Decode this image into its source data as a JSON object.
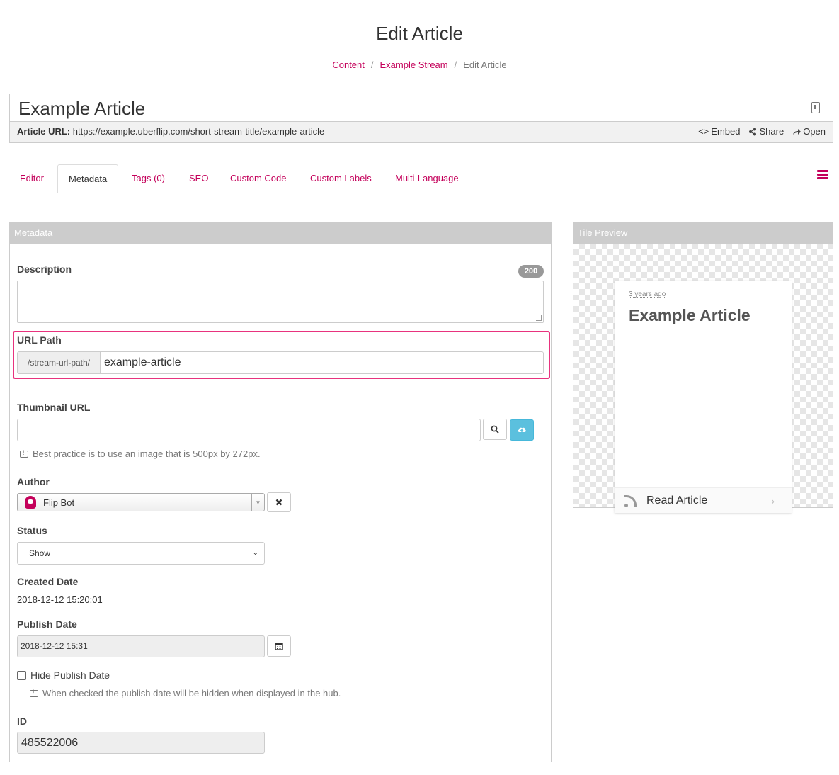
{
  "header": {
    "title": "Edit Article",
    "breadcrumb": [
      "Content",
      "Example Stream",
      "Edit Article"
    ]
  },
  "article": {
    "title": "Example Article",
    "url_label": "Article URL:",
    "url": "https://example.uberflip.com/short-stream-title/example-article",
    "actions": {
      "embed": "Embed",
      "share": "Share",
      "open": "Open"
    }
  },
  "tabs": [
    {
      "label": "Editor",
      "active": false
    },
    {
      "label": "Metadata",
      "active": true
    },
    {
      "label": "Tags (0)",
      "active": false
    },
    {
      "label": "SEO",
      "active": false
    },
    {
      "label": "Custom Code",
      "active": false
    },
    {
      "label": "Custom Labels",
      "active": false
    },
    {
      "label": "Multi-Language",
      "active": false
    }
  ],
  "metadata": {
    "heading": "Metadata",
    "description": {
      "label": "Description",
      "count": "200",
      "value": ""
    },
    "url_path": {
      "label": "URL Path",
      "prefix": "/stream-url-path/",
      "value": "example-article"
    },
    "thumbnail": {
      "label": "Thumbnail URL",
      "value": "",
      "help": "Best practice is to use an image that is 500px by 272px."
    },
    "author": {
      "label": "Author",
      "value": "Flip Bot"
    },
    "status": {
      "label": "Status",
      "value": "Show"
    },
    "created": {
      "label": "Created Date",
      "value": "2018-12-12 15:20:01"
    },
    "publish": {
      "label": "Publish Date",
      "value": "2018-12-12 15:31"
    },
    "hide_publish": {
      "label": "Hide Publish Date",
      "checked": false,
      "help": "When checked the publish date will be hidden when displayed in the hub."
    },
    "id": {
      "label": "ID",
      "value": "485522006"
    }
  },
  "tile_preview": {
    "heading": "Tile Preview",
    "time": "3 years ago",
    "title": "Example Article",
    "cta": "Read Article"
  },
  "colors": {
    "accent": "#c4005a",
    "highlight": "#e8337e",
    "upload_button": "#5bc0de"
  },
  "icons": {
    "search": "magnifier-icon",
    "upload": "cloud-upload-icon",
    "clear": "close-icon",
    "calendar": "calendar-icon",
    "menu": "hamburger-icon",
    "rss": "rss-icon"
  }
}
